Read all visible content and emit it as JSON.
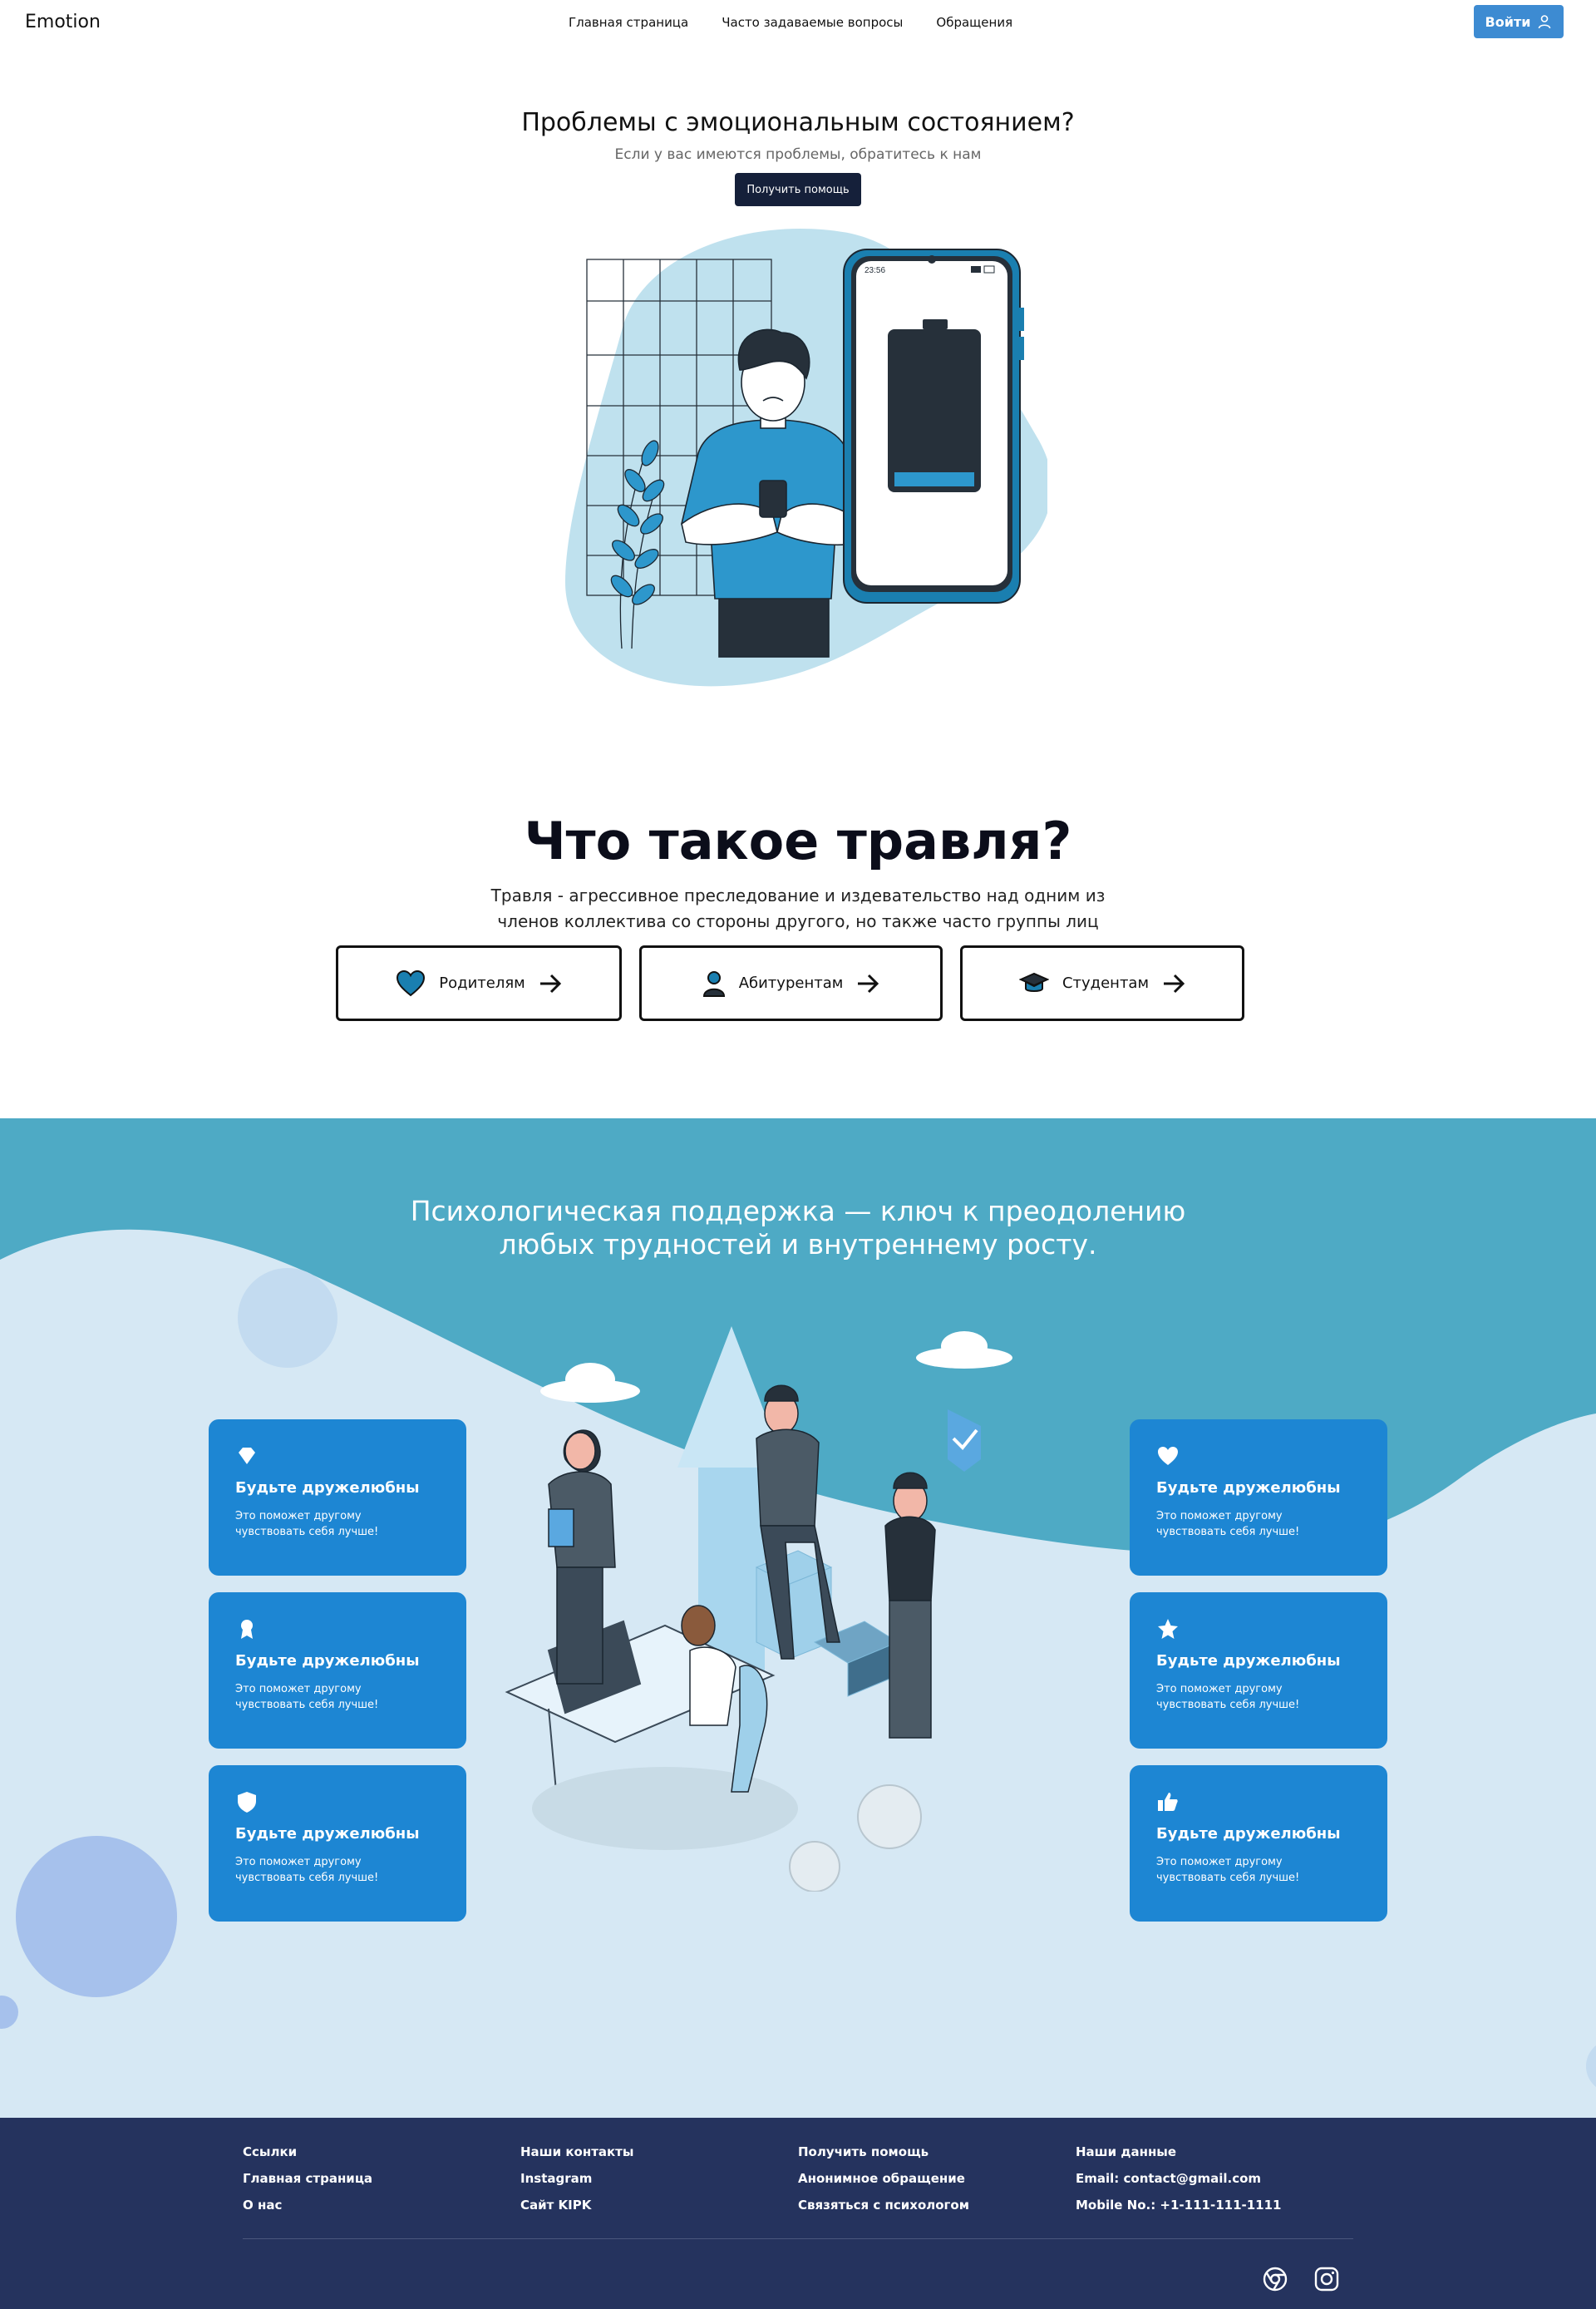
{
  "nav": {
    "logo": "Emotion",
    "links": [
      "Главная страница",
      "Часто задаваемые вопросы",
      "Обращения"
    ],
    "login_label": "Войти"
  },
  "hero": {
    "title": "Проблемы с эмоциональным состоянием?",
    "subtitle": "Если у вас имеются проблемы, обратитесь к нам",
    "button": "Получить помощь",
    "phone_time": "23:56"
  },
  "bullying": {
    "title": "Что такое травля?",
    "description": "Травля - агрессивное преследование и издевательство над одним из членов коллектива со стороны другого, но также часто группы лиц",
    "categories": [
      {
        "label": "Родителям",
        "icon": "heart-icon"
      },
      {
        "label": "Абитурентам",
        "icon": "user-icon"
      },
      {
        "label": "Студентам",
        "icon": "graduation-cap-icon"
      }
    ]
  },
  "support": {
    "title": "Психологическая поддержка — ключ к преодолению любых трудностей и внутреннему росту.",
    "cards": [
      {
        "icon": "gem-icon",
        "title": "Будьте дружелюбны",
        "text": "Это поможет другому чувствовать себя лучше!"
      },
      {
        "icon": "award-icon",
        "title": "Будьте дружелюбны",
        "text": "Это поможет другому чувствовать себя лучше!"
      },
      {
        "icon": "shield-icon",
        "title": "Будьте дружелюбны",
        "text": "Это поможет другому чувствовать себя лучше!"
      },
      {
        "icon": "heart-icon",
        "title": "Будьте дружелюбны",
        "text": "Это поможет другому чувствовать себя лучше!"
      },
      {
        "icon": "star-icon",
        "title": "Будьте дружелюбны",
        "text": "Это поможет другому чувствовать себя лучше!"
      },
      {
        "icon": "thumbs-up-icon",
        "title": "Будьте дружелюбны",
        "text": "Это поможет другому чувствовать себя лучше!"
      }
    ]
  },
  "footer": {
    "columns": [
      {
        "heading": "Ссылки",
        "items": [
          "Главная страница",
          "О нас"
        ]
      },
      {
        "heading": "Наши контакты",
        "items": [
          "Instagram",
          "Сайт KIPK"
        ]
      },
      {
        "heading": "Получить помощь",
        "items": [
          "Анонимное обращение",
          "Связяться с психологом"
        ]
      },
      {
        "heading": "Наши данные",
        "items": [
          "Email: contact@gmail.com",
          "Mobile No.: +1-111-111-1111"
        ]
      }
    ],
    "social": [
      "chrome-icon",
      "instagram-icon"
    ]
  },
  "colors": {
    "primary": "#3d8bd2",
    "dark": "#15203a",
    "support_bg": "#4eaac5",
    "card": "#1d86d3",
    "footer": "#25335e"
  }
}
